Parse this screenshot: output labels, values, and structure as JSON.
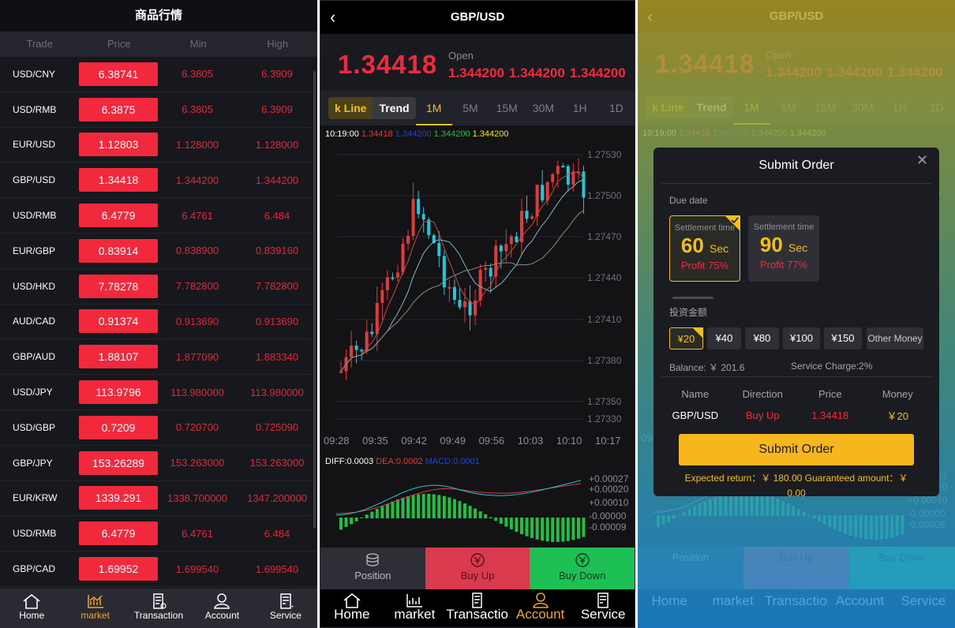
{
  "market": {
    "title": "商品行情",
    "columns": [
      "Trade",
      "Price",
      "Min",
      "High"
    ],
    "rows": [
      {
        "symbol": "USD/CNY",
        "price": "6.38741",
        "min": "6.3805",
        "high": "6.3909"
      },
      {
        "symbol": "USD/RMB",
        "price": "6.3875",
        "min": "6.3805",
        "high": "6.3909"
      },
      {
        "symbol": "EUR/USD",
        "price": "1.12803",
        "min": "1.128000",
        "high": "1.128000"
      },
      {
        "symbol": "GBP/USD",
        "price": "1.34418",
        "min": "1.344200",
        "high": "1.344200"
      },
      {
        "symbol": "USD/RMB",
        "price": "6.4779",
        "min": "6.4761",
        "high": "6.484"
      },
      {
        "symbol": "EUR/GBP",
        "price": "0.83914",
        "min": "0.838900",
        "high": "0.839160"
      },
      {
        "symbol": "USD/HKD",
        "price": "7.78278",
        "min": "7.782800",
        "high": "7.782800"
      },
      {
        "symbol": "AUD/CAD",
        "price": "0.91374",
        "min": "0.913690",
        "high": "0.913690"
      },
      {
        "symbol": "GBP/AUD",
        "price": "1.88107",
        "min": "1.877090",
        "high": "1.883340"
      },
      {
        "symbol": "USD/JPY",
        "price": "113.9796",
        "min": "113.980000",
        "high": "113.980000"
      },
      {
        "symbol": "USD/GBP",
        "price": "0.7209",
        "min": "0.720700",
        "high": "0.725090"
      },
      {
        "symbol": "GBP/JPY",
        "price": "153.26289",
        "min": "153.263000",
        "high": "153.263000"
      },
      {
        "symbol": "EUR/KRW",
        "price": "1339.291",
        "min": "1338.700000",
        "high": "1347.200000"
      },
      {
        "symbol": "USD/RMB",
        "price": "6.4779",
        "min": "6.4761",
        "high": "6.484"
      },
      {
        "symbol": "GBP/CAD",
        "price": "1.69952",
        "min": "1.699540",
        "high": "1.699540"
      }
    ]
  },
  "tabbar": {
    "items": [
      {
        "label": "Home",
        "icon": "home-icon"
      },
      {
        "label": "market",
        "icon": "chart-icon"
      },
      {
        "label": "Transaction",
        "icon": "transaction-icon"
      },
      {
        "label": "Account",
        "icon": "user-icon"
      },
      {
        "label": "Service",
        "icon": "service-icon"
      }
    ]
  },
  "detail": {
    "back_icon": "back-icon",
    "title": "GBP/USD",
    "price": "1.34418",
    "open_label": "Open",
    "open_values": [
      "1.344200",
      "1.344200",
      "1.344200"
    ],
    "mode_tabs": [
      "k Line",
      "Trend"
    ],
    "timeframes": [
      "1M",
      "5M",
      "15M",
      "30M",
      "1H",
      "1D"
    ],
    "legend": {
      "time": "10:19:00",
      "v1": "1.34418",
      "v2": "1.344200",
      "v3": "1.344200",
      "v4": "1.344200"
    },
    "price_ticks": [
      "1.27530",
      "1.27500",
      "1.27470",
      "1.27440",
      "1.27410",
      "1.27380",
      "1.27350",
      "1.27330"
    ],
    "time_ticks": [
      "09:28",
      "09:35",
      "09:42",
      "09:49",
      "09:56",
      "10:03",
      "10:10",
      "10:17"
    ],
    "macd_legend": {
      "diff": "DIFF:0.0003",
      "dea": "DEA:0.0002",
      "macd": "MACD:0.0001"
    },
    "macd_ticks": [
      "+0.00027",
      "+0.00020",
      "+0.00010",
      "-0.00000",
      "-0.00009"
    ],
    "actions": {
      "position": "Position",
      "buy_up": "Buy Up",
      "buy_down": "Buy Down"
    },
    "colors": {
      "up": "#e23a3a",
      "down": "#22c7d8",
      "macd_up": "#1fc043",
      "buy_up_bg": "#d93a4e",
      "buy_down_bg": "#1dc055"
    }
  },
  "order": {
    "title": "Submit Order",
    "due_date_label": "Due date",
    "cards": [
      {
        "label": "Settlement time",
        "seconds": "60",
        "unit": "Sec",
        "profit": "Profit 75%"
      },
      {
        "label": "Settlement time",
        "seconds": "90",
        "unit": "Sec",
        "profit": "Profit 77%"
      }
    ],
    "amount_label": "投资金额",
    "amounts": [
      "¥20",
      "¥40",
      "¥80",
      "¥100",
      "¥150",
      "Other Money"
    ],
    "balance": "Balance: ￥ 201.6",
    "service_charge": "Service Charge:2%",
    "table_headers": [
      "Name",
      "Direction",
      "Price",
      "Money"
    ],
    "table_row": {
      "name": "GBP/USD",
      "direction": "Buy Up",
      "price": "1.34418",
      "money": "￥20"
    },
    "submit_label": "Submit Order",
    "expected_return": "Expected return：￥ 180.00    Guaranteed amount：￥ 0.00"
  }
}
